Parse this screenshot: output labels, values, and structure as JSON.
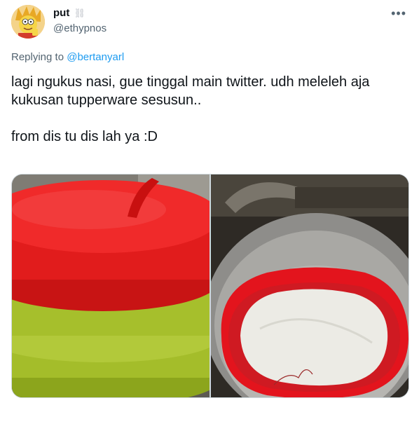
{
  "author": {
    "display_name": "put",
    "name_emoji": "⛓",
    "handle": "@ethypnos",
    "avatar_icon": "avatar-cartoon-icon"
  },
  "reply": {
    "prefix": "Replying to ",
    "target": "@bertanyarl"
  },
  "tweet": {
    "text": "lagi ngukus nasi, gue tinggal main twitter. udh meleleh aja\nkukusan tupperware sesusun..\n\nfrom dis tu dis lah ya :D"
  },
  "actions": {
    "more_icon": "more-horizontal-icon",
    "more_glyph": "•••"
  },
  "media": {
    "photos": [
      {
        "name": "photo-stacked-tupperware-steamer"
      },
      {
        "name": "photo-melted-steamer-in-pot"
      }
    ]
  },
  "colors": {
    "link": "#1d9bf0",
    "secondary_text": "#536471",
    "primary_text": "#0f1419"
  }
}
